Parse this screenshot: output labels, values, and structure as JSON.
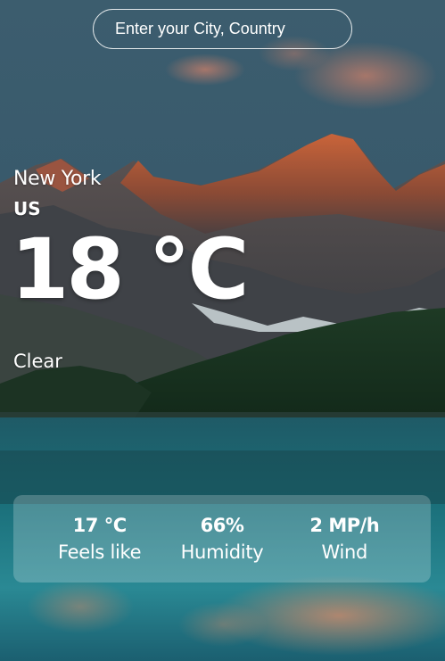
{
  "search": {
    "placeholder": "Enter your City, Country",
    "value": ""
  },
  "location": {
    "city": "New York",
    "country": "US"
  },
  "weather": {
    "temperature": "18 °C",
    "condition": "Clear"
  },
  "stats": [
    {
      "value": "17 °C",
      "label": "Feels like"
    },
    {
      "value": "66%",
      "label": "Humidity"
    },
    {
      "value": "2 MP/h",
      "label": "Wind"
    }
  ]
}
